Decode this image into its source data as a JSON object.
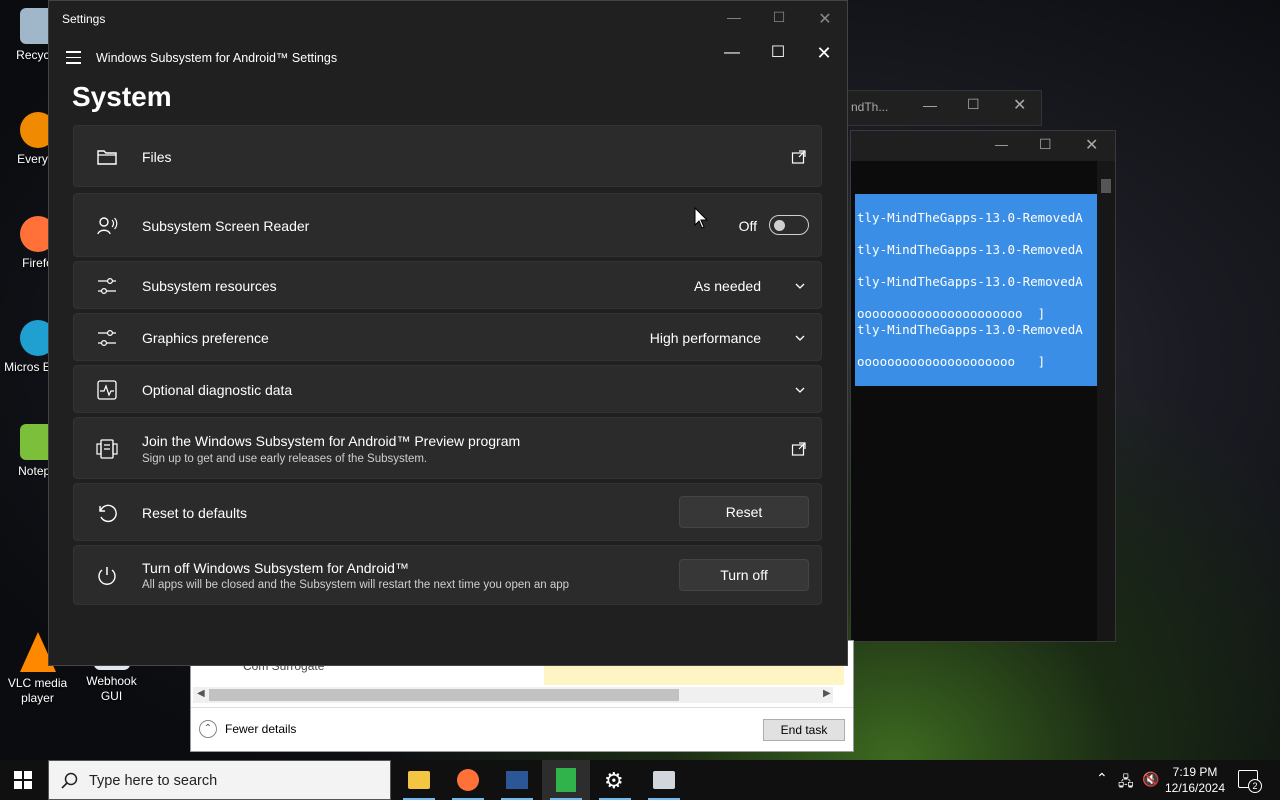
{
  "desktop": {
    "icons": [
      {
        "label": "Recycle",
        "color": "#9fb7c9"
      },
      {
        "label": "Everyth",
        "color": "#f08a00"
      },
      {
        "label": "Firefo",
        "color": "#ff7139"
      },
      {
        "label": "Micros Edge",
        "color": "#1fa0d0"
      },
      {
        "label": "Notepa",
        "color": "#7bbf3a"
      },
      {
        "label": "VLC media player",
        "color": "#ff8800"
      },
      {
        "label": "Webhook GUI",
        "color": "#dfe8ef"
      }
    ]
  },
  "bg_window": {
    "title": "ndTh..."
  },
  "terminal": {
    "lines": [
      "tly-MindTheGapps-13.0-RemovedA",
      "tly-MindTheGapps-13.0-RemovedA",
      "tly-MindTheGapps-13.0-RemovedA",
      "oooooooooooooooooooooo  ]",
      "tly-MindTheGapps-13.0-RemovedA",
      "ooooooooooooooooooooo   ]"
    ]
  },
  "task_manager": {
    "row_text": "Com Surrogate",
    "fewer_details": "Fewer details",
    "end_task": "End task"
  },
  "settings": {
    "outer_title": "Settings",
    "inner_title": "Windows Subsystem for Android™ Settings",
    "page_title": "System",
    "cards": {
      "files": {
        "label": "Files"
      },
      "screen_reader": {
        "label": "Subsystem Screen Reader",
        "value": "Off"
      },
      "resources": {
        "label": "Subsystem resources",
        "value": "As needed"
      },
      "graphics": {
        "label": "Graphics preference",
        "value": "High performance"
      },
      "diagnostic": {
        "label": "Optional diagnostic data"
      },
      "preview": {
        "label": "Join the Windows Subsystem for Android™ Preview program",
        "sub": "Sign up to get and use early releases of the Subsystem."
      },
      "reset": {
        "label": "Reset to defaults",
        "button": "Reset"
      },
      "turnoff": {
        "label": "Turn off Windows Subsystem for Android™",
        "sub": "All apps will be closed and the Subsystem will restart the next time you open an app",
        "button": "Turn off"
      }
    }
  },
  "taskbar": {
    "search_placeholder": "Type here to search",
    "time": "7:19 PM",
    "date": "12/16/2024",
    "notification_count": "2",
    "accent": "#76b9ed"
  }
}
